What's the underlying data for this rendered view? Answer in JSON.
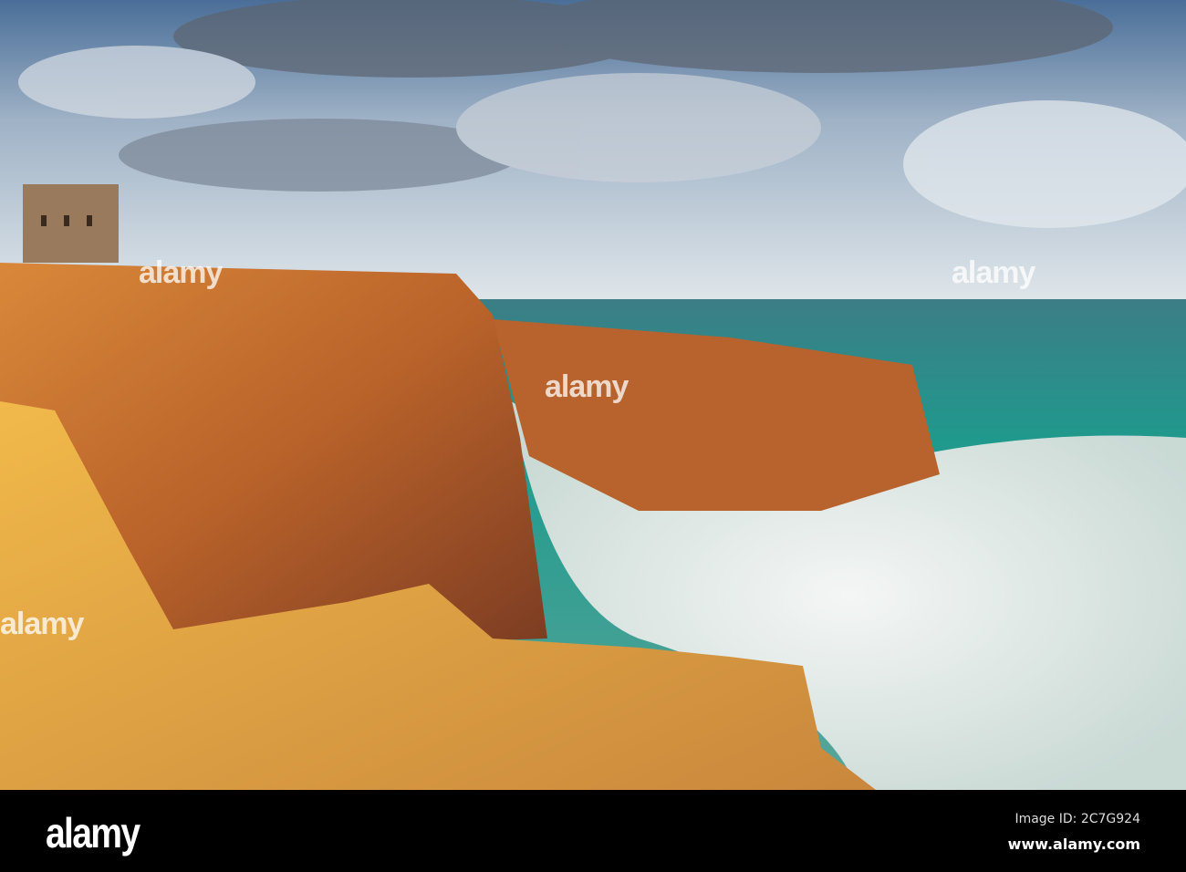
{
  "photo": {
    "subject": "Coastal cliffs with watchtower and stormy sea"
  },
  "watermark": {
    "text": "alamy"
  },
  "footer": {
    "logo": "alamy",
    "image_id": "Image ID: 2C7G924",
    "url": "www.alamy.com"
  },
  "colors": {
    "sky": "#6f93b8",
    "sea": "#2f8a86",
    "cliff": "#c9772f",
    "rock": "#e2a53e",
    "foam": "#eef2f0"
  }
}
